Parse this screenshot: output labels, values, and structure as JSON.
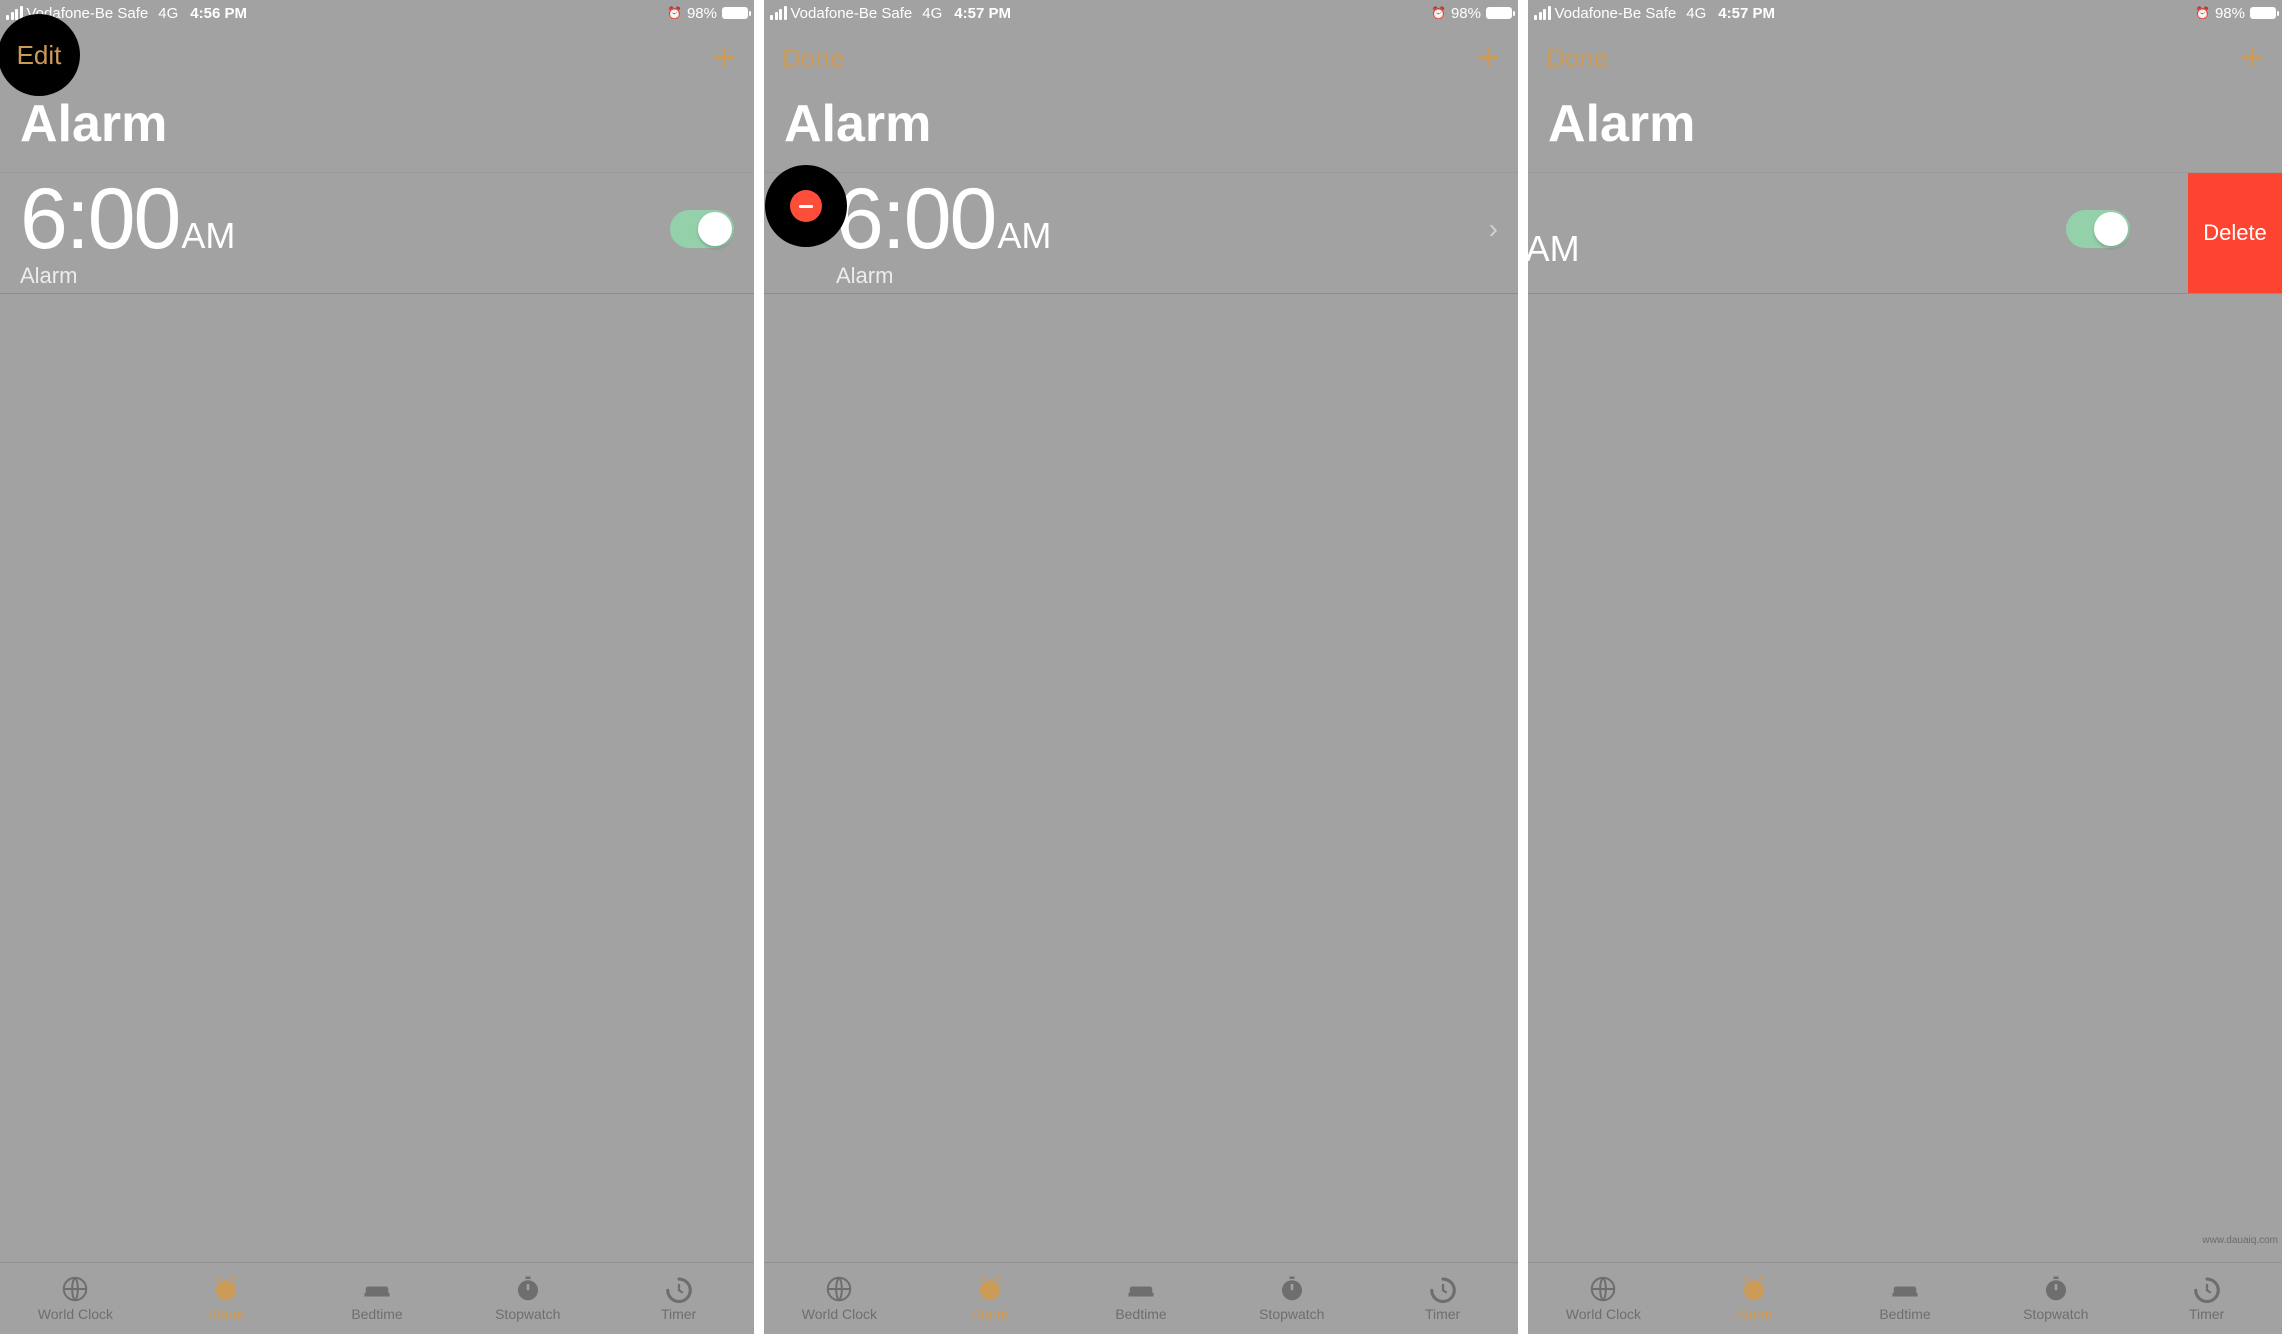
{
  "status": {
    "carrier": "Vodafone-Be Safe",
    "network": "4G",
    "time_a": "4:56 PM",
    "time_b": "4:57 PM",
    "time_c": "4:57 PM",
    "battery": "98%"
  },
  "nav": {
    "edit": "Edit",
    "done": "Done"
  },
  "page": {
    "title": "Alarm"
  },
  "alarm": {
    "time": "6:00",
    "time_trunc": "00",
    "ampm": "AM",
    "label": "Alarm"
  },
  "actions": {
    "delete": "Delete"
  },
  "tabs": {
    "world_clock": "World Clock",
    "alarm": "Alarm",
    "bedtime": "Bedtime",
    "stopwatch": "Stopwatch",
    "timer": "Timer"
  },
  "watermark": "www.dauaiq.com"
}
